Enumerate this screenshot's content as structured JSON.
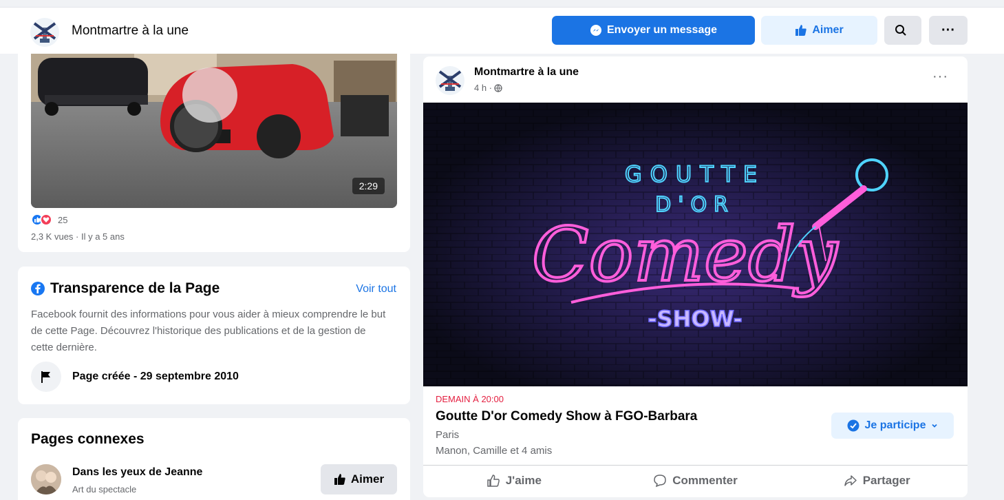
{
  "header": {
    "page_name": "Montmartre à la une",
    "message_button": "Envoyer un message",
    "like_button": "Aimer",
    "search_icon": "search-icon",
    "more_icon": "more-icon",
    "more_label": "···"
  },
  "video_card": {
    "duration": "2:29",
    "reaction_count": "25",
    "views": "2,3 K vues · Il y a 5 ans"
  },
  "transparency": {
    "title": "Transparence de la Page",
    "see_all": "Voir tout",
    "description": "Facebook fournit des informations pour vous aider à mieux comprendre le but de cette Page. Découvrez l'historique des publications et de la gestion de cette dernière.",
    "created": "Page créée - 29 septembre 2010"
  },
  "related_pages": {
    "title": "Pages connexes",
    "items": [
      {
        "name": "Dans les yeux de Jeanne",
        "category": "Art du spectacle",
        "like_label": "Aimer"
      }
    ]
  },
  "post": {
    "author": "Montmartre à la une",
    "time": "4 h ·",
    "more_label": "···",
    "banner": {
      "line1": "GOUTTE",
      "line2": "D'OR",
      "line3": "Comedy",
      "line4": "-SHOW-"
    },
    "event": {
      "date": "DEMAIN À 20:00",
      "title": "Goutte D'or Comedy Show à FGO-Barbara",
      "place": "Paris",
      "friends": "Manon, Camille et 4 amis",
      "going_label": "Je participe"
    },
    "actions": {
      "like": "J'aime",
      "comment": "Commenter",
      "share": "Partager"
    }
  },
  "colors": {
    "accent": "#1b74e4",
    "accent_light": "#e7f3ff",
    "event_date": "#e41e3f",
    "neon_blue": "#4fd3ff",
    "neon_pink": "#ff5edb"
  }
}
